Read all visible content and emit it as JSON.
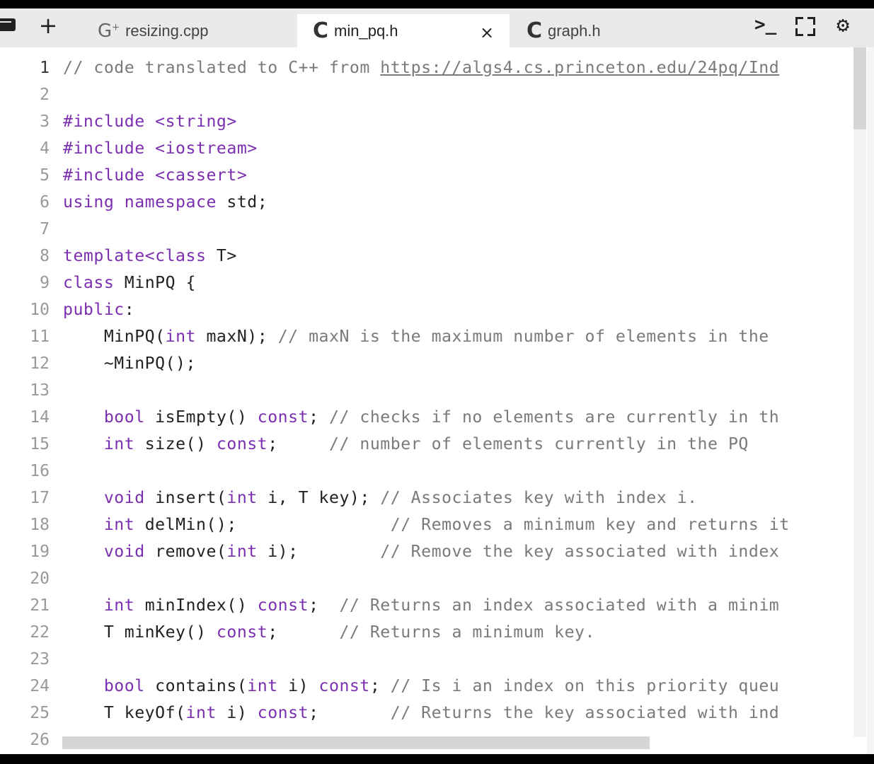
{
  "tabs": [
    {
      "label": "resizing.cpp",
      "icon": "cpp-file-icon",
      "active": false
    },
    {
      "label": "min_pq.h",
      "icon": "c-file-icon",
      "active": true
    },
    {
      "label": "graph.h",
      "icon": "c-file-icon",
      "active": false
    }
  ],
  "icons": {
    "add": "+",
    "close": "×",
    "terminal": ">_",
    "settings": "⚙",
    "cpp_glyph": "G",
    "cpp_sup": "+",
    "c_glyph": "C"
  },
  "colors": {
    "keyword": "#7b2fb0",
    "comment": "#7a7a7a",
    "text": "#222222"
  },
  "editor": {
    "active_line": "1",
    "lines": [
      {
        "n": "1",
        "segs": [
          {
            "c": "cm",
            "t": "// code translated to C++ from "
          },
          {
            "c": "cm link",
            "t": "https://algs4.cs.princeton.edu/24pq/Ind"
          }
        ]
      },
      {
        "n": "2",
        "segs": []
      },
      {
        "n": "3",
        "segs": [
          {
            "c": "kw",
            "t": "#include <string>"
          }
        ]
      },
      {
        "n": "4",
        "segs": [
          {
            "c": "kw",
            "t": "#include <iostream>"
          }
        ]
      },
      {
        "n": "5",
        "segs": [
          {
            "c": "kw",
            "t": "#include <cassert>"
          }
        ]
      },
      {
        "n": "6",
        "segs": [
          {
            "c": "kw",
            "t": "using namespace"
          },
          {
            "c": "",
            "t": " std;"
          }
        ]
      },
      {
        "n": "7",
        "segs": []
      },
      {
        "n": "8",
        "segs": [
          {
            "c": "kw",
            "t": "template<class"
          },
          {
            "c": "",
            "t": " T>"
          }
        ]
      },
      {
        "n": "9",
        "segs": [
          {
            "c": "kw",
            "t": "class"
          },
          {
            "c": "",
            "t": " MinPQ {"
          }
        ]
      },
      {
        "n": "10",
        "segs": [
          {
            "c": "kw",
            "t": "public"
          },
          {
            "c": "",
            "t": ":"
          }
        ]
      },
      {
        "n": "11",
        "segs": [
          {
            "c": "",
            "t": "    MinPQ("
          },
          {
            "c": "kw",
            "t": "int"
          },
          {
            "c": "",
            "t": " maxN); "
          },
          {
            "c": "cm",
            "t": "// maxN is the maximum number of elements in the"
          }
        ]
      },
      {
        "n": "12",
        "segs": [
          {
            "c": "",
            "t": "    ~MinPQ();"
          }
        ]
      },
      {
        "n": "13",
        "segs": []
      },
      {
        "n": "14",
        "segs": [
          {
            "c": "",
            "t": "    "
          },
          {
            "c": "kw",
            "t": "bool"
          },
          {
            "c": "",
            "t": " isEmpty() "
          },
          {
            "c": "kw",
            "t": "const"
          },
          {
            "c": "",
            "t": "; "
          },
          {
            "c": "cm",
            "t": "// checks if no elements are currently in th"
          }
        ]
      },
      {
        "n": "15",
        "segs": [
          {
            "c": "",
            "t": "    "
          },
          {
            "c": "kw",
            "t": "int"
          },
          {
            "c": "",
            "t": " size() "
          },
          {
            "c": "kw",
            "t": "const"
          },
          {
            "c": "",
            "t": ";     "
          },
          {
            "c": "cm",
            "t": "// number of elements currently in the PQ"
          }
        ]
      },
      {
        "n": "16",
        "segs": []
      },
      {
        "n": "17",
        "segs": [
          {
            "c": "",
            "t": "    "
          },
          {
            "c": "kw",
            "t": "void"
          },
          {
            "c": "",
            "t": " insert("
          },
          {
            "c": "kw",
            "t": "int"
          },
          {
            "c": "",
            "t": " i, T key); "
          },
          {
            "c": "cm",
            "t": "// Associates key with index i."
          }
        ]
      },
      {
        "n": "18",
        "segs": [
          {
            "c": "",
            "t": "    "
          },
          {
            "c": "kw",
            "t": "int"
          },
          {
            "c": "",
            "t": " delMin();               "
          },
          {
            "c": "cm",
            "t": "// Removes a minimum key and returns it"
          }
        ]
      },
      {
        "n": "19",
        "segs": [
          {
            "c": "",
            "t": "    "
          },
          {
            "c": "kw",
            "t": "void"
          },
          {
            "c": "",
            "t": " remove("
          },
          {
            "c": "kw",
            "t": "int"
          },
          {
            "c": "",
            "t": " i);        "
          },
          {
            "c": "cm",
            "t": "// Remove the key associated with index"
          }
        ]
      },
      {
        "n": "20",
        "segs": []
      },
      {
        "n": "21",
        "segs": [
          {
            "c": "",
            "t": "    "
          },
          {
            "c": "kw",
            "t": "int"
          },
          {
            "c": "",
            "t": " minIndex() "
          },
          {
            "c": "kw",
            "t": "const"
          },
          {
            "c": "",
            "t": ";  "
          },
          {
            "c": "cm",
            "t": "// Returns an index associated with a minim"
          }
        ]
      },
      {
        "n": "22",
        "segs": [
          {
            "c": "",
            "t": "    T minKey() "
          },
          {
            "c": "kw",
            "t": "const"
          },
          {
            "c": "",
            "t": ";      "
          },
          {
            "c": "cm",
            "t": "// Returns a minimum key."
          }
        ]
      },
      {
        "n": "23",
        "segs": []
      },
      {
        "n": "24",
        "segs": [
          {
            "c": "",
            "t": "    "
          },
          {
            "c": "kw",
            "t": "bool"
          },
          {
            "c": "",
            "t": " contains("
          },
          {
            "c": "kw",
            "t": "int"
          },
          {
            "c": "",
            "t": " i) "
          },
          {
            "c": "kw",
            "t": "const"
          },
          {
            "c": "",
            "t": "; "
          },
          {
            "c": "cm",
            "t": "// Is i an index on this priority queu"
          }
        ]
      },
      {
        "n": "25",
        "segs": [
          {
            "c": "",
            "t": "    T keyOf("
          },
          {
            "c": "kw",
            "t": "int"
          },
          {
            "c": "",
            "t": " i) "
          },
          {
            "c": "kw",
            "t": "const"
          },
          {
            "c": "",
            "t": ";       "
          },
          {
            "c": "cm",
            "t": "// Returns the key associated with ind"
          }
        ]
      },
      {
        "n": "26",
        "segs": []
      }
    ]
  }
}
